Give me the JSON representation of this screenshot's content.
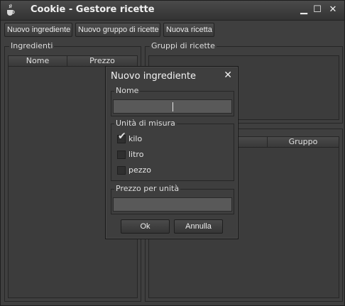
{
  "window": {
    "title": "Cookie - Gestore ricette",
    "minimize_glyph": "▁",
    "maximize_glyph": "☐",
    "close_glyph": "✕"
  },
  "toolbar": {
    "new_ingredient": "Nuovo ingrediente",
    "new_recipe_group": "Nuovo gruppo di ricette",
    "new_recipe": "Nuova ricetta"
  },
  "ingredients_panel": {
    "title": "Ingredienti",
    "columns": [
      "Nome",
      "Prezzo"
    ]
  },
  "groups_panel": {
    "title": "Gruppi di ricette"
  },
  "recipes_panel": {
    "columns": [
      "",
      "Gruppo"
    ]
  },
  "dialog": {
    "title": "Nuovo ingrediente",
    "close_glyph": "✕",
    "name_section": "Nome",
    "name_value": "",
    "unit_section": "Unità di misura",
    "units": [
      {
        "label": "kilo",
        "checked": true
      },
      {
        "label": "litro",
        "checked": false
      },
      {
        "label": "pezzo",
        "checked": false
      }
    ],
    "check_glyph": "✔",
    "price_section": "Prezzo per unità",
    "price_value": "",
    "ok_label": "Ok",
    "cancel_label": "Annulla"
  }
}
